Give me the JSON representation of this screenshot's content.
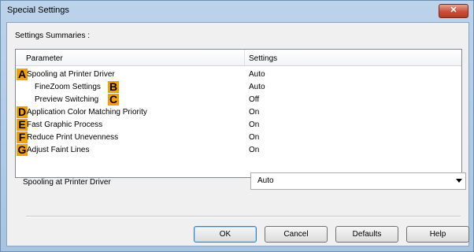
{
  "window": {
    "title": "Special Settings",
    "close_glyph": "✕"
  },
  "summaries_label": "Settings Summaries :",
  "list": {
    "columns": {
      "parameter": "Parameter",
      "settings": "Settings"
    },
    "rows": [
      {
        "marker": "A",
        "parameter": "Spooling at Printer Driver",
        "setting": "Auto"
      },
      {
        "marker": "B",
        "parameter": "FineZoom Settings",
        "setting": "Auto"
      },
      {
        "marker": "C",
        "parameter": "Preview Switching",
        "setting": "Off"
      },
      {
        "marker": "D",
        "parameter": "Application Color Matching Priority",
        "setting": "On"
      },
      {
        "marker": "E",
        "parameter": "Fast Graphic Process",
        "setting": "On"
      },
      {
        "marker": "F",
        "parameter": "Reduce Print Unevenness",
        "setting": "On"
      },
      {
        "marker": "G",
        "parameter": "Adjust Faint Lines",
        "setting": "On"
      }
    ]
  },
  "option": {
    "label": "Spooling at Printer Driver",
    "value": "Auto"
  },
  "buttons": {
    "ok": "OK",
    "cancel": "Cancel",
    "defaults": "Defaults",
    "help": "Help"
  },
  "colors": {
    "marker": "#f5a000",
    "close_button": "#c8503a",
    "title_bar": "#bcd3ea"
  },
  "icons": {
    "close": "close-icon",
    "dropdown": "chevron-down-icon"
  }
}
